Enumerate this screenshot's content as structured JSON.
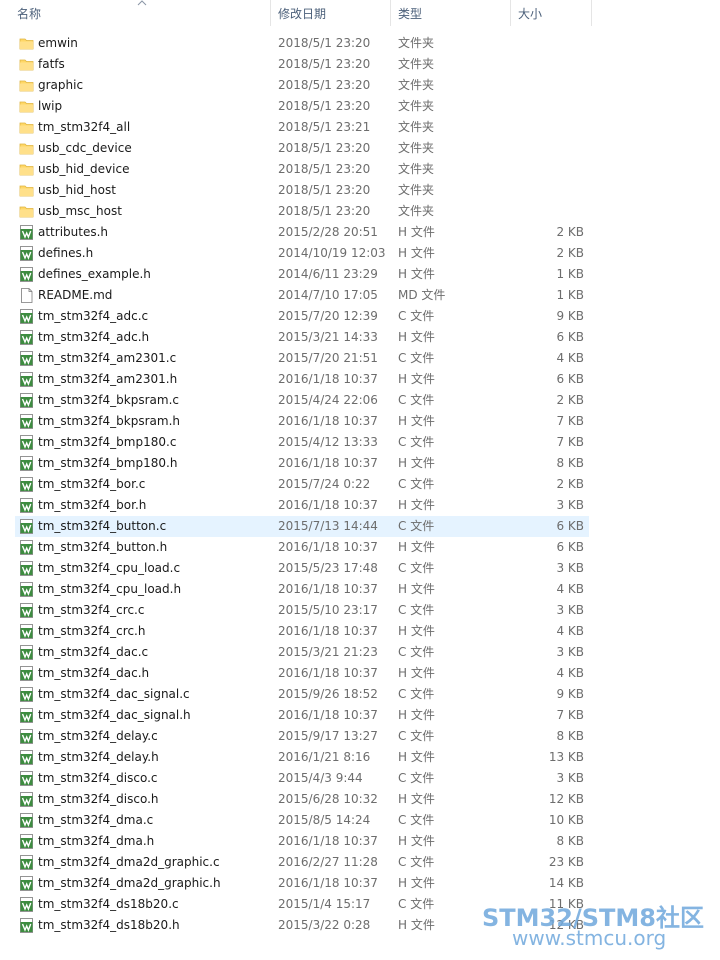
{
  "columns": {
    "name": "名称",
    "modified": "修改日期",
    "type": "类型",
    "size": "大小"
  },
  "files": [
    {
      "name": "emwin",
      "date": "2018/5/1 23:20",
      "type": "文件夹",
      "size": "",
      "icon": "folder-icon"
    },
    {
      "name": "fatfs",
      "date": "2018/5/1 23:20",
      "type": "文件夹",
      "size": "",
      "icon": "folder-icon"
    },
    {
      "name": "graphic",
      "date": "2018/5/1 23:20",
      "type": "文件夹",
      "size": "",
      "icon": "folder-icon"
    },
    {
      "name": "lwip",
      "date": "2018/5/1 23:20",
      "type": "文件夹",
      "size": "",
      "icon": "folder-icon"
    },
    {
      "name": "tm_stm32f4_all",
      "date": "2018/5/1 23:21",
      "type": "文件夹",
      "size": "",
      "icon": "folder-icon"
    },
    {
      "name": "usb_cdc_device",
      "date": "2018/5/1 23:20",
      "type": "文件夹",
      "size": "",
      "icon": "folder-icon"
    },
    {
      "name": "usb_hid_device",
      "date": "2018/5/1 23:20",
      "type": "文件夹",
      "size": "",
      "icon": "folder-icon"
    },
    {
      "name": "usb_hid_host",
      "date": "2018/5/1 23:20",
      "type": "文件夹",
      "size": "",
      "icon": "folder-icon"
    },
    {
      "name": "usb_msc_host",
      "date": "2018/5/1 23:20",
      "type": "文件夹",
      "size": "",
      "icon": "folder-icon"
    },
    {
      "name": "attributes.h",
      "date": "2015/2/28 20:51",
      "type": "H 文件",
      "size": "2 KB",
      "icon": "source-file-icon"
    },
    {
      "name": "defines.h",
      "date": "2014/10/19 12:03",
      "type": "H 文件",
      "size": "2 KB",
      "icon": "source-file-icon"
    },
    {
      "name": "defines_example.h",
      "date": "2014/6/11 23:29",
      "type": "H 文件",
      "size": "1 KB",
      "icon": "source-file-icon"
    },
    {
      "name": "README.md",
      "date": "2014/7/10 17:05",
      "type": "MD 文件",
      "size": "1 KB",
      "icon": "text-file-icon"
    },
    {
      "name": "tm_stm32f4_adc.c",
      "date": "2015/7/20 12:39",
      "type": "C 文件",
      "size": "9 KB",
      "icon": "source-file-icon"
    },
    {
      "name": "tm_stm32f4_adc.h",
      "date": "2015/3/21 14:33",
      "type": "H 文件",
      "size": "6 KB",
      "icon": "source-file-icon"
    },
    {
      "name": "tm_stm32f4_am2301.c",
      "date": "2015/7/20 21:51",
      "type": "C 文件",
      "size": "4 KB",
      "icon": "source-file-icon"
    },
    {
      "name": "tm_stm32f4_am2301.h",
      "date": "2016/1/18 10:37",
      "type": "H 文件",
      "size": "6 KB",
      "icon": "source-file-icon"
    },
    {
      "name": "tm_stm32f4_bkpsram.c",
      "date": "2015/4/24 22:06",
      "type": "C 文件",
      "size": "2 KB",
      "icon": "source-file-icon"
    },
    {
      "name": "tm_stm32f4_bkpsram.h",
      "date": "2016/1/18 10:37",
      "type": "H 文件",
      "size": "7 KB",
      "icon": "source-file-icon"
    },
    {
      "name": "tm_stm32f4_bmp180.c",
      "date": "2015/4/12 13:33",
      "type": "C 文件",
      "size": "7 KB",
      "icon": "source-file-icon"
    },
    {
      "name": "tm_stm32f4_bmp180.h",
      "date": "2016/1/18 10:37",
      "type": "H 文件",
      "size": "8 KB",
      "icon": "source-file-icon"
    },
    {
      "name": "tm_stm32f4_bor.c",
      "date": "2015/7/24 0:22",
      "type": "C 文件",
      "size": "2 KB",
      "icon": "source-file-icon"
    },
    {
      "name": "tm_stm32f4_bor.h",
      "date": "2016/1/18 10:37",
      "type": "H 文件",
      "size": "3 KB",
      "icon": "source-file-icon"
    },
    {
      "name": "tm_stm32f4_button.c",
      "date": "2015/7/13 14:44",
      "type": "C 文件",
      "size": "6 KB",
      "icon": "source-file-icon",
      "selected": true
    },
    {
      "name": "tm_stm32f4_button.h",
      "date": "2016/1/18 10:37",
      "type": "H 文件",
      "size": "6 KB",
      "icon": "source-file-icon"
    },
    {
      "name": "tm_stm32f4_cpu_load.c",
      "date": "2015/5/23 17:48",
      "type": "C 文件",
      "size": "3 KB",
      "icon": "source-file-icon"
    },
    {
      "name": "tm_stm32f4_cpu_load.h",
      "date": "2016/1/18 10:37",
      "type": "H 文件",
      "size": "4 KB",
      "icon": "source-file-icon"
    },
    {
      "name": "tm_stm32f4_crc.c",
      "date": "2015/5/10 23:17",
      "type": "C 文件",
      "size": "3 KB",
      "icon": "source-file-icon"
    },
    {
      "name": "tm_stm32f4_crc.h",
      "date": "2016/1/18 10:37",
      "type": "H 文件",
      "size": "4 KB",
      "icon": "source-file-icon"
    },
    {
      "name": "tm_stm32f4_dac.c",
      "date": "2015/3/21 21:23",
      "type": "C 文件",
      "size": "3 KB",
      "icon": "source-file-icon"
    },
    {
      "name": "tm_stm32f4_dac.h",
      "date": "2016/1/18 10:37",
      "type": "H 文件",
      "size": "4 KB",
      "icon": "source-file-icon"
    },
    {
      "name": "tm_stm32f4_dac_signal.c",
      "date": "2015/9/26 18:52",
      "type": "C 文件",
      "size": "9 KB",
      "icon": "source-file-icon"
    },
    {
      "name": "tm_stm32f4_dac_signal.h",
      "date": "2016/1/18 10:37",
      "type": "H 文件",
      "size": "7 KB",
      "icon": "source-file-icon"
    },
    {
      "name": "tm_stm32f4_delay.c",
      "date": "2015/9/17 13:27",
      "type": "C 文件",
      "size": "8 KB",
      "icon": "source-file-icon"
    },
    {
      "name": "tm_stm32f4_delay.h",
      "date": "2016/1/21 8:16",
      "type": "H 文件",
      "size": "13 KB",
      "icon": "source-file-icon"
    },
    {
      "name": "tm_stm32f4_disco.c",
      "date": "2015/4/3 9:44",
      "type": "C 文件",
      "size": "3 KB",
      "icon": "source-file-icon"
    },
    {
      "name": "tm_stm32f4_disco.h",
      "date": "2015/6/28 10:32",
      "type": "H 文件",
      "size": "12 KB",
      "icon": "source-file-icon"
    },
    {
      "name": "tm_stm32f4_dma.c",
      "date": "2015/8/5 14:24",
      "type": "C 文件",
      "size": "10 KB",
      "icon": "source-file-icon"
    },
    {
      "name": "tm_stm32f4_dma.h",
      "date": "2016/1/18 10:37",
      "type": "H 文件",
      "size": "8 KB",
      "icon": "source-file-icon"
    },
    {
      "name": "tm_stm32f4_dma2d_graphic.c",
      "date": "2016/2/27 11:28",
      "type": "C 文件",
      "size": "23 KB",
      "icon": "source-file-icon"
    },
    {
      "name": "tm_stm32f4_dma2d_graphic.h",
      "date": "2016/1/18 10:37",
      "type": "H 文件",
      "size": "14 KB",
      "icon": "source-file-icon"
    },
    {
      "name": "tm_stm32f4_ds18b20.c",
      "date": "2015/1/4 15:17",
      "type": "C 文件",
      "size": "11 KB",
      "icon": "source-file-icon"
    },
    {
      "name": "tm_stm32f4_ds18b20.h",
      "date": "2015/3/22 0:28",
      "type": "H 文件",
      "size": "12 KB",
      "icon": "source-file-icon"
    }
  ],
  "watermark": {
    "line1": "STM32/STM8社区",
    "line2": "www.stmcu.org"
  },
  "colors": {
    "selected_row": "#e5f3ff",
    "header_text": "#4c607a",
    "folder": "#ffd766",
    "source_icon": "#3d8c40"
  }
}
